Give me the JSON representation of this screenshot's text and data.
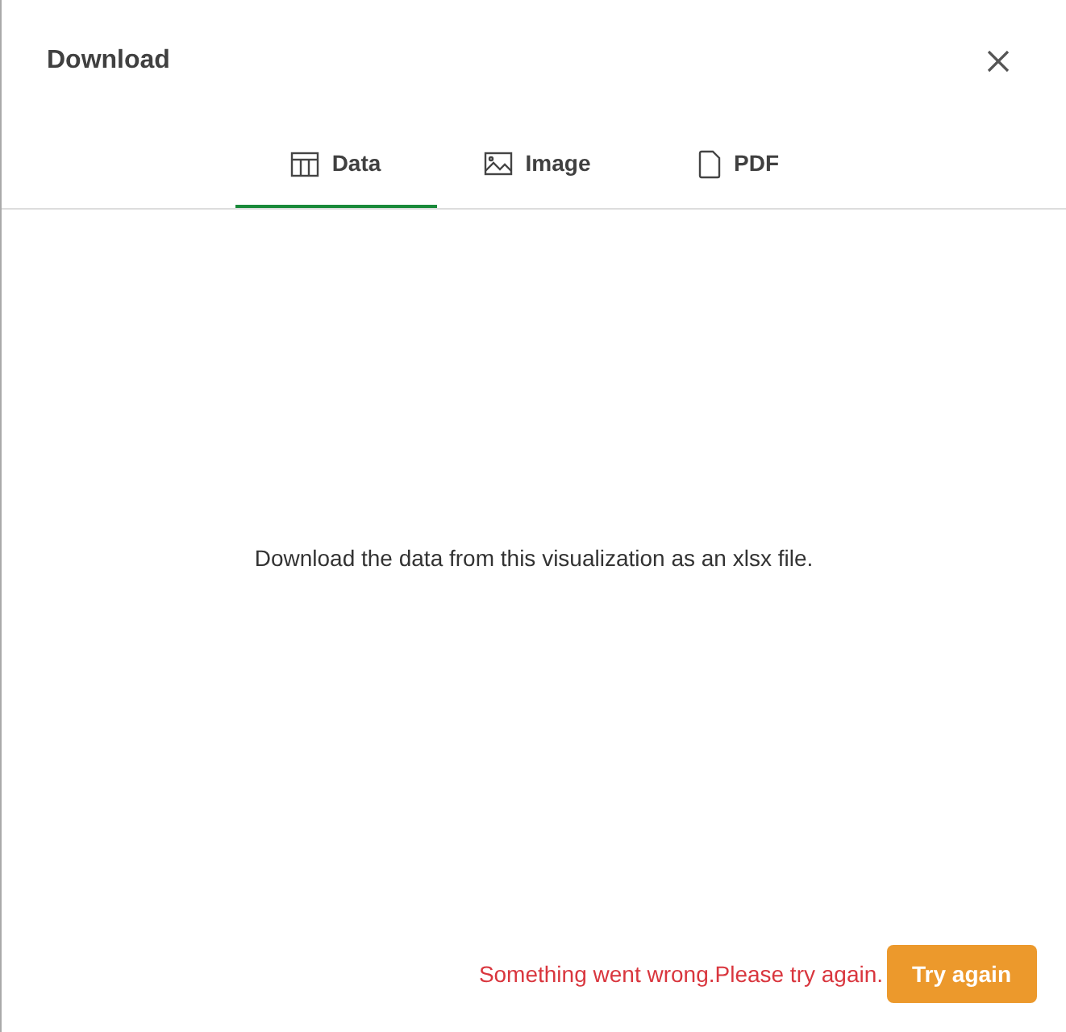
{
  "dialog": {
    "title": "Download"
  },
  "tabs": [
    {
      "label": "Data",
      "kind": "table",
      "selected": true
    },
    {
      "label": "Image",
      "kind": "image",
      "selected": false
    },
    {
      "label": "PDF",
      "kind": "file",
      "selected": false
    }
  ],
  "message": "Download the data from this visualization as an xlsx file.",
  "error": "Something went wrong.Please try again.",
  "button": "Try again"
}
